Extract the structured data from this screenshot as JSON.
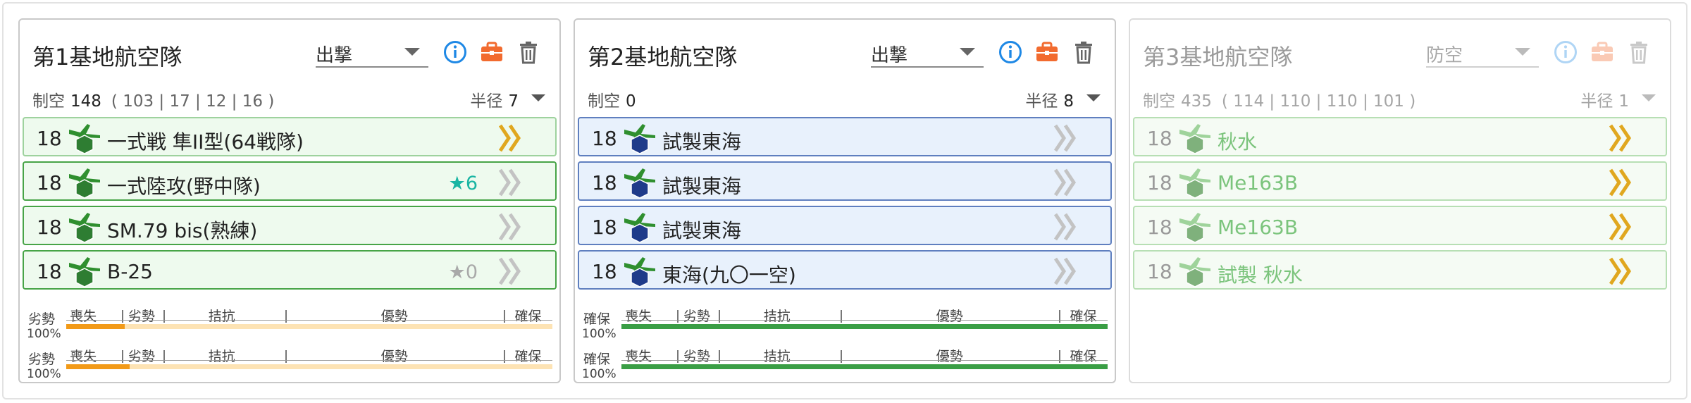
{
  "panels": [
    {
      "title": "第1基地航空隊",
      "mode": "出撃",
      "seiku_label": "制空",
      "seiku": "148",
      "seiku_detail": "( 103 | 17 | 12 | 16 )",
      "radius_label": "半径",
      "radius": "7",
      "style": "green",
      "slots": [
        {
          "count": "18",
          "name": "一式戦 隼II型(64戦隊)",
          "badge": "陸",
          "star": "",
          "chevron": "gold"
        },
        {
          "count": "18",
          "name": "一式陸攻(野中隊)",
          "badge": "陸",
          "star": "★6",
          "chevron": "grey"
        },
        {
          "count": "18",
          "name": "SM.79 bis(熟練)",
          "badge": "陸",
          "star": "",
          "chevron": "grey"
        },
        {
          "count": "18",
          "name": "B-25",
          "badge": "陸",
          "star": "★0",
          "chevron": "grey"
        }
      ],
      "bars": [
        {
          "status": "劣勢",
          "percent": "100%",
          "fill": 0.12,
          "color": "#f29a18"
        },
        {
          "status": "劣勢",
          "percent": "100%",
          "fill": 0.13,
          "color": "#f29a18"
        }
      ]
    },
    {
      "title": "第2基地航空隊",
      "mode": "出撃",
      "seiku_label": "制空",
      "seiku": "0",
      "seiku_detail": "",
      "radius_label": "半径",
      "radius": "8",
      "style": "blue",
      "slots": [
        {
          "count": "18",
          "name": "試製東海",
          "badge": "哨",
          "star": "",
          "chevron": "grey"
        },
        {
          "count": "18",
          "name": "試製東海",
          "badge": "哨",
          "star": "",
          "chevron": "grey"
        },
        {
          "count": "18",
          "name": "試製東海",
          "badge": "哨",
          "star": "",
          "chevron": "grey"
        },
        {
          "count": "18",
          "name": "東海(九〇一空)",
          "badge": "哨",
          "star": "",
          "chevron": "grey"
        }
      ],
      "bars": [
        {
          "status": "確保",
          "percent": "100%",
          "fill": 1.0,
          "color": "#3a9e45"
        },
        {
          "status": "確保",
          "percent": "100%",
          "fill": 1.0,
          "color": "#3a9e45"
        }
      ]
    },
    {
      "title": "第3基地航空隊",
      "mode": "防空",
      "seiku_label": "制空",
      "seiku": "435",
      "seiku_detail": "( 114 | 110 | 110 | 101 )",
      "radius_label": "半径",
      "radius": "1",
      "style": "faded",
      "slots": [
        {
          "count": "18",
          "name": "秋水",
          "badge": "局",
          "star": "",
          "chevron": "gold"
        },
        {
          "count": "18",
          "name": "Me163B",
          "badge": "局",
          "star": "",
          "chevron": "gold"
        },
        {
          "count": "18",
          "name": "Me163B",
          "badge": "局",
          "star": "",
          "chevron": "gold"
        },
        {
          "count": "18",
          "name": "試製 秋水",
          "badge": "局",
          "star": "",
          "chevron": "gold"
        }
      ],
      "bars": []
    }
  ],
  "bar_labels": [
    "喪失",
    "劣勢",
    "拮抗",
    "優勢",
    "確保"
  ],
  "colors": {
    "accent_blue": "#1e88e5",
    "toolbox_orange": "#f26b2f",
    "green_border": "#47a447",
    "blue_border": "#5f7fbf",
    "chevron_gold": "#e0a71f",
    "chevron_grey": "#c3c3c3"
  },
  "icons": [
    "info-icon",
    "toolbox-icon",
    "trash-icon",
    "plane-icon",
    "chevron-icon",
    "star-icon",
    "caret-down-icon"
  ]
}
